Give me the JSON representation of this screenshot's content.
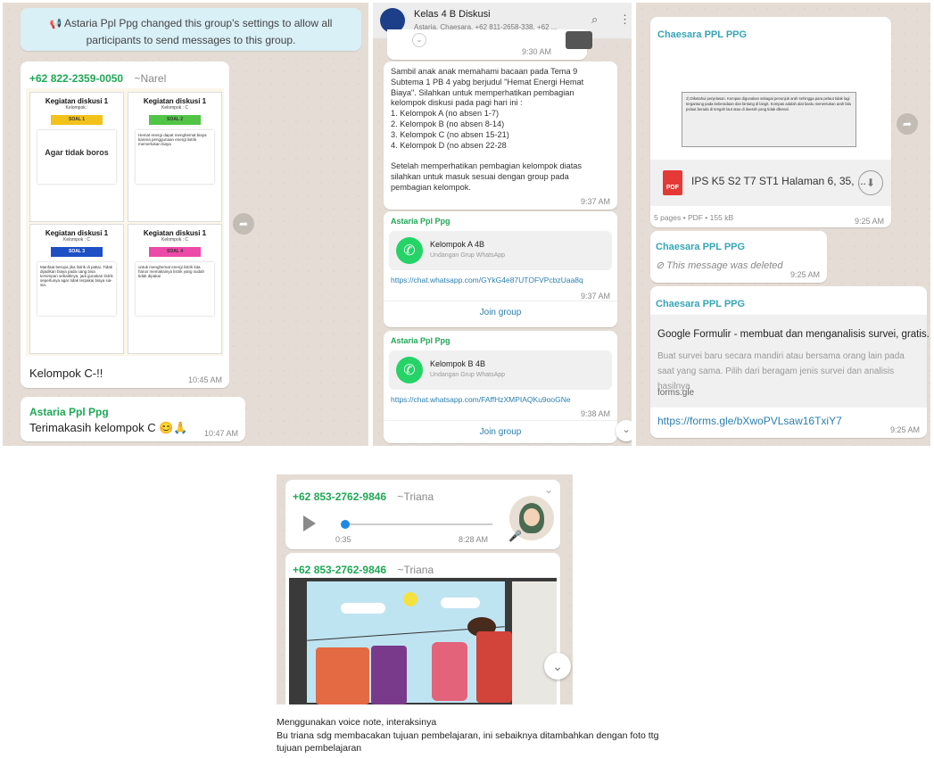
{
  "panel1": {
    "system_message": "Astaria Ppl Ppg changed this group's settings to allow all participants to send messages to this group.",
    "msg1": {
      "sender": "+62 822-2359-0050",
      "alias": "~Narel",
      "cards": [
        {
          "title": "Kegiatan diskusi 1",
          "sub": "Kelompok :",
          "tag": "SOAL 1",
          "tag_color": "#f2c21b",
          "body": "Agar tidak boros"
        },
        {
          "title": "Kegiatan diskusi 1",
          "sub": "Kelompok : C",
          "tag": "SOAL 2",
          "tag_color": "#52c447",
          "body": "Hemat energi dapat menghemat biaya karena penggunaan energi listrik memerlukan biaya"
        },
        {
          "title": "Kegiatan diskusi 1",
          "sub": "Kelompok : C",
          "tag": "SOAL 3",
          "tag_color": "#1e4fc4",
          "body": "Manfaat berupa jika listrik di pakai. Tidak dijadikan biaya pada uang bisa tersimpan sebaliknya, jadi gunakan listrik seperlunya agar tidak terpakai biaya sia-sia."
        },
        {
          "title": "Kegiatan diskusi 1",
          "sub": "Kelompok : C",
          "tag": "SOAL 4",
          "tag_color": "#ec4aa9",
          "body": "untuk menghemat energi listrik kita harus memakainya listrik yang sudah tidak dipakai"
        }
      ],
      "caption": "Kelompok C-!!",
      "time": "10:45 AM"
    },
    "msg2": {
      "sender": "Astaria Ppl Ppg",
      "text": "Terimakasih kelompok C 😊🙏",
      "time": "10:47 AM"
    }
  },
  "panel2": {
    "header": {
      "title": "Kelas 4 B Diskusi",
      "subtitle": "Astaria, Chaesara, +62 811-2658-338, +62 ..."
    },
    "top_time": "9:30 AM",
    "announcement": {
      "lines": [
        "Sambil anak anak memahami bacaan pada Tema 9",
        "Subtema 1 PB 4 yabg berjudul \"Hemat Energi Hemat",
        "Biaya\". Silahkan untuk memperhatikan pembagian",
        "kelompok diskusi pada pagi hari ini :",
        "1. Kelompok A (no absen 1-7)",
        "2. Kelompok B (no absen 8-14)",
        "3. Kelompok C (no absen 15-21)",
        "4. Kelompok D (no absen 22-28",
        "",
        "Setelah memperhatikan pembagian kelompok diatas",
        "silahkan untuk masuk sesuai dengan group pada",
        "pembagian kelompok."
      ],
      "time": "9:37 AM"
    },
    "invite1": {
      "sender": "Astaria Ppl Ppg",
      "title": "Kelompok A 4B",
      "subtitle": "Undangan Grup WhatsApp",
      "link": "https://chat.whatsapp.com/GYkG4e87UTOFVPcbzUaa8q",
      "time": "9:37 AM",
      "join": "Join group"
    },
    "invite2": {
      "sender": "Astaria Ppl Ppg",
      "title": "Kelompok B 4B",
      "subtitle": "Undangan Grup WhatsApp",
      "link": "https://chat.whatsapp.com/FAffHzXMPIAQKu9ooGNe",
      "time": "9:38 AM",
      "join": "Join group"
    }
  },
  "panel3": {
    "doc": {
      "sender": "Chaesara PPL PPG",
      "preview_text": "2) Diketahui penjelasan. Kompas digunakan sebagai penunjuk arah sehingga para pelaut tidak lagi tergantung pada keberadaan dan bintang di langit. Kompas adalah alat bantu menentukan arah bila pelaut berada di tengah laut atau di daerah yang tidak dikenal.",
      "filename": "IPS K5 S2 T7 ST1 Halaman 6, 35, ...",
      "pdf_label": "PDF",
      "meta": "5 pages • PDF • 155 kB",
      "time": "9:25 AM"
    },
    "deleted": {
      "sender": "Chaesara PPL PPG",
      "text": "This message was deleted",
      "time": "9:25 AM"
    },
    "link_msg": {
      "sender": "Chaesara PPL PPG",
      "preview_title": "Google Formulir - membuat dan menganalisis survei, gratis.",
      "preview_desc": "Buat survei baru secara mandiri atau bersama orang lain pada saat yang sama. Pilih dari beragam jenis survei dan analisis hasilnya",
      "domain": "forms.gle",
      "link": "https://forms.gle/bXwoPVLsaw16TxiY7",
      "time": "9:25 AM"
    }
  },
  "panel4": {
    "voice": {
      "sender": "+62 853-2762-9846",
      "alias": "~Triana",
      "duration": "0:35",
      "time": "8:28 AM",
      "progress": 0.03
    },
    "image_msg": {
      "sender": "+62 853-2762-9846",
      "alias": "~Triana"
    }
  },
  "caption": {
    "line1": "Menggunakan voice note, interaksinya",
    "line2": "Bu triana sdg membacakan tujuan pembelajaran, ini sebaiknya ditambahkan dengan foto ttg",
    "line3": "tujuan pembelajaran"
  },
  "icons": {
    "megaphone": "megaphone-icon",
    "forward": "forward-icon",
    "search": "search-icon",
    "menu": "menu-icon",
    "whatsapp": "whatsapp-icon",
    "download": "download-icon",
    "deleted": "deleted-icon",
    "play": "play-icon",
    "mic": "mic-icon",
    "chevron": "chevron-down-icon"
  },
  "colors": {
    "chat_bg": "#e5ddd5",
    "system_bubble": "#d9f0f7",
    "green_name": "#1fa855",
    "teal_name": "#35a5b8",
    "link": "#2a7fb0",
    "whatsapp_green": "#25d366"
  }
}
